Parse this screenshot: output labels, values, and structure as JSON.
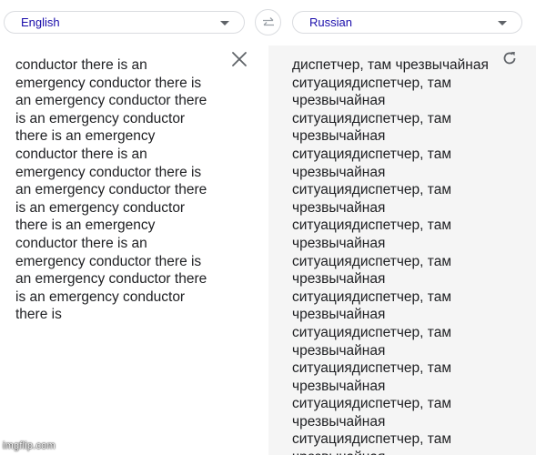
{
  "source_language": {
    "label": "English",
    "icon": "chevron-down-icon"
  },
  "target_language": {
    "label": "Russian",
    "icon": "chevron-down-icon"
  },
  "swap_icon": "swap-arrows-icon",
  "source_text": "conductor there is an emergency conductor there is an emergency conductor there is an emergency conductor there is an emergency conductor there is an emergency conductor there is an emergency conductor there is an emergency conductor there is an emergency conductor there is an emergency conductor there is an emergency conductor there is an emergency conductor there is",
  "translated_text": "диспетчер, там чрезвычайная ситуациядиспетчер, там чрезвычайная ситуациядиспетчер, там чрезвычайная ситуациядиспетчер, там чрезвычайная ситуациядиспетчер, там чрезвычайная ситуациядиспетчер, там чрезвычайная ситуациядиспетчер, там чрезвычайная ситуациядиспетчер, там чрезвычайная ситуациядиспетчер, там чрезвычайная ситуациядиспетчер, там чрезвычайная ситуациядиспетчер, там чрезвычайная ситуациядиспетчер, там чрезвычайная",
  "clear_icon": "close-icon",
  "refresh_icon": "refresh-icon",
  "watermark": "imgflip.com",
  "colors": {
    "language_text": "#1a0dab",
    "body_text": "#202124",
    "target_background": "#f5f5f5",
    "border": "#dadce0",
    "icon": "#5f6368"
  }
}
